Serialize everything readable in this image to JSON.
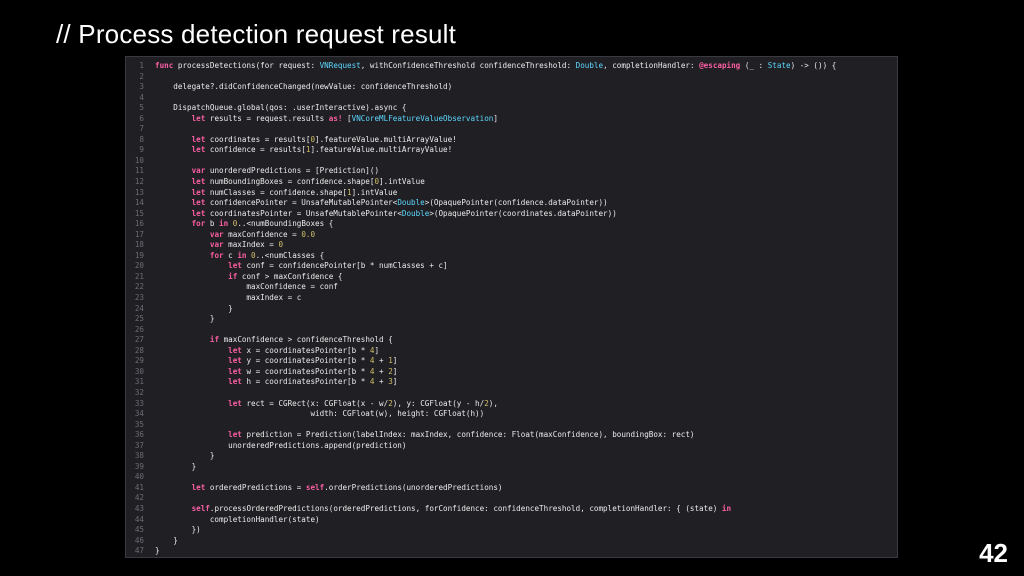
{
  "slide": {
    "title": "// Process detection request result",
    "page_number": "42"
  },
  "colors": {
    "background": "#000000",
    "panel": "#1f1f24",
    "keyword": "#fc5fa3",
    "type": "#5dd8ff",
    "number": "#d0bf69",
    "line_number": "#6c6c74",
    "text": "#ececec"
  },
  "code": {
    "lines": [
      {
        "n": "1",
        "tokens": [
          {
            "t": "func",
            "c": "keyword"
          },
          {
            "t": " processDetections(for request: "
          },
          {
            "t": "VNRequest",
            "c": "type"
          },
          {
            "t": ", withConfidenceThreshold confidenceThreshold: "
          },
          {
            "t": "Double",
            "c": "type"
          },
          {
            "t": ", completionHandler: "
          },
          {
            "t": "@escaping",
            "c": "keyword"
          },
          {
            "t": " (_ : "
          },
          {
            "t": "State",
            "c": "type"
          },
          {
            "t": ") -> ()) {"
          }
        ]
      },
      {
        "n": "2",
        "tokens": []
      },
      {
        "n": "3",
        "tokens": [
          {
            "t": "    delegate?.didConfidenceChanged(newValue: confidenceThreshold)"
          }
        ]
      },
      {
        "n": "4",
        "tokens": []
      },
      {
        "n": "5",
        "tokens": [
          {
            "t": "    DispatchQueue.global(qos: .userInteractive).async {"
          }
        ]
      },
      {
        "n": "6",
        "tokens": [
          {
            "t": "        "
          },
          {
            "t": "let",
            "c": "keyword"
          },
          {
            "t": " results = request.results "
          },
          {
            "t": "as!",
            "c": "keyword"
          },
          {
            "t": " ["
          },
          {
            "t": "VNCoreMLFeatureValueObservation",
            "c": "type"
          },
          {
            "t": "]"
          }
        ]
      },
      {
        "n": "7",
        "tokens": []
      },
      {
        "n": "8",
        "tokens": [
          {
            "t": "        "
          },
          {
            "t": "let",
            "c": "keyword"
          },
          {
            "t": " coordinates = results["
          },
          {
            "t": "0",
            "c": "number"
          },
          {
            "t": "].featureValue.multiArrayValue!"
          }
        ]
      },
      {
        "n": "9",
        "tokens": [
          {
            "t": "        "
          },
          {
            "t": "let",
            "c": "keyword"
          },
          {
            "t": " confidence = results["
          },
          {
            "t": "1",
            "c": "number"
          },
          {
            "t": "].featureValue.multiArrayValue!"
          }
        ]
      },
      {
        "n": "10",
        "tokens": []
      },
      {
        "n": "11",
        "tokens": [
          {
            "t": "        "
          },
          {
            "t": "var",
            "c": "keyword"
          },
          {
            "t": " unorderedPredictions = [Prediction]()"
          }
        ]
      },
      {
        "n": "12",
        "tokens": [
          {
            "t": "        "
          },
          {
            "t": "let",
            "c": "keyword"
          },
          {
            "t": " numBoundingBoxes = confidence.shape["
          },
          {
            "t": "0",
            "c": "number"
          },
          {
            "t": "].intValue"
          }
        ]
      },
      {
        "n": "13",
        "tokens": [
          {
            "t": "        "
          },
          {
            "t": "let",
            "c": "keyword"
          },
          {
            "t": " numClasses = confidence.shape["
          },
          {
            "t": "1",
            "c": "number"
          },
          {
            "t": "].intValue"
          }
        ]
      },
      {
        "n": "14",
        "tokens": [
          {
            "t": "        "
          },
          {
            "t": "let",
            "c": "keyword"
          },
          {
            "t": " confidencePointer = UnsafeMutablePointer<"
          },
          {
            "t": "Double",
            "c": "type"
          },
          {
            "t": ">(OpaquePointer(confidence.dataPointer))"
          }
        ]
      },
      {
        "n": "15",
        "tokens": [
          {
            "t": "        "
          },
          {
            "t": "let",
            "c": "keyword"
          },
          {
            "t": " coordinatesPointer = UnsafeMutablePointer<"
          },
          {
            "t": "Double",
            "c": "type"
          },
          {
            "t": ">(OpaquePointer(coordinates.dataPointer))"
          }
        ]
      },
      {
        "n": "16",
        "tokens": [
          {
            "t": "        "
          },
          {
            "t": "for",
            "c": "keyword"
          },
          {
            "t": " b "
          },
          {
            "t": "in",
            "c": "keyword"
          },
          {
            "t": " "
          },
          {
            "t": "0",
            "c": "number"
          },
          {
            "t": "..<numBoundingBoxes {"
          }
        ]
      },
      {
        "n": "17",
        "tokens": [
          {
            "t": "            "
          },
          {
            "t": "var",
            "c": "keyword"
          },
          {
            "t": " maxConfidence = "
          },
          {
            "t": "0.0",
            "c": "number"
          }
        ]
      },
      {
        "n": "18",
        "tokens": [
          {
            "t": "            "
          },
          {
            "t": "var",
            "c": "keyword"
          },
          {
            "t": " maxIndex = "
          },
          {
            "t": "0",
            "c": "number"
          }
        ]
      },
      {
        "n": "19",
        "tokens": [
          {
            "t": "            "
          },
          {
            "t": "for",
            "c": "keyword"
          },
          {
            "t": " c "
          },
          {
            "t": "in",
            "c": "keyword"
          },
          {
            "t": " "
          },
          {
            "t": "0",
            "c": "number"
          },
          {
            "t": "..<numClasses {"
          }
        ]
      },
      {
        "n": "20",
        "tokens": [
          {
            "t": "                "
          },
          {
            "t": "let",
            "c": "keyword"
          },
          {
            "t": " conf = confidencePointer[b * numClasses + c]"
          }
        ]
      },
      {
        "n": "21",
        "tokens": [
          {
            "t": "                "
          },
          {
            "t": "if",
            "c": "keyword"
          },
          {
            "t": " conf > maxConfidence {"
          }
        ]
      },
      {
        "n": "22",
        "tokens": [
          {
            "t": "                    maxConfidence = conf"
          }
        ]
      },
      {
        "n": "23",
        "tokens": [
          {
            "t": "                    maxIndex = c"
          }
        ]
      },
      {
        "n": "24",
        "tokens": [
          {
            "t": "                }"
          }
        ]
      },
      {
        "n": "25",
        "tokens": [
          {
            "t": "            }"
          }
        ]
      },
      {
        "n": "26",
        "tokens": []
      },
      {
        "n": "27",
        "tokens": [
          {
            "t": "            "
          },
          {
            "t": "if",
            "c": "keyword"
          },
          {
            "t": " maxConfidence > confidenceThreshold {"
          }
        ]
      },
      {
        "n": "28",
        "tokens": [
          {
            "t": "                "
          },
          {
            "t": "let",
            "c": "keyword"
          },
          {
            "t": " x = coordinatesPointer[b * "
          },
          {
            "t": "4",
            "c": "number"
          },
          {
            "t": "]"
          }
        ]
      },
      {
        "n": "29",
        "tokens": [
          {
            "t": "                "
          },
          {
            "t": "let",
            "c": "keyword"
          },
          {
            "t": " y = coordinatesPointer[b * "
          },
          {
            "t": "4",
            "c": "number"
          },
          {
            "t": " + "
          },
          {
            "t": "1",
            "c": "number"
          },
          {
            "t": "]"
          }
        ]
      },
      {
        "n": "30",
        "tokens": [
          {
            "t": "                "
          },
          {
            "t": "let",
            "c": "keyword"
          },
          {
            "t": " w = coordinatesPointer[b * "
          },
          {
            "t": "4",
            "c": "number"
          },
          {
            "t": " + "
          },
          {
            "t": "2",
            "c": "number"
          },
          {
            "t": "]"
          }
        ]
      },
      {
        "n": "31",
        "tokens": [
          {
            "t": "                "
          },
          {
            "t": "let",
            "c": "keyword"
          },
          {
            "t": " h = coordinatesPointer[b * "
          },
          {
            "t": "4",
            "c": "number"
          },
          {
            "t": " + "
          },
          {
            "t": "3",
            "c": "number"
          },
          {
            "t": "]"
          }
        ]
      },
      {
        "n": "32",
        "tokens": []
      },
      {
        "n": "33",
        "tokens": [
          {
            "t": "                "
          },
          {
            "t": "let",
            "c": "keyword"
          },
          {
            "t": " rect = CGRect(x: CGFloat(x - w/"
          },
          {
            "t": "2",
            "c": "number"
          },
          {
            "t": "), y: CGFloat(y - h/"
          },
          {
            "t": "2",
            "c": "number"
          },
          {
            "t": "),"
          }
        ]
      },
      {
        "n": "34",
        "tokens": [
          {
            "t": "                                  width: CGFloat(w), height: CGFloat(h))"
          }
        ]
      },
      {
        "n": "35",
        "tokens": []
      },
      {
        "n": "36",
        "tokens": [
          {
            "t": "                "
          },
          {
            "t": "let",
            "c": "keyword"
          },
          {
            "t": " prediction = Prediction(labelIndex: maxIndex, confidence: Float(maxConfidence), boundingBox: rect)"
          }
        ]
      },
      {
        "n": "37",
        "tokens": [
          {
            "t": "                unorderedPredictions.append(prediction)"
          }
        ]
      },
      {
        "n": "38",
        "tokens": [
          {
            "t": "            }"
          }
        ]
      },
      {
        "n": "39",
        "tokens": [
          {
            "t": "        }"
          }
        ]
      },
      {
        "n": "40",
        "tokens": []
      },
      {
        "n": "41",
        "tokens": [
          {
            "t": "        "
          },
          {
            "t": "let",
            "c": "keyword"
          },
          {
            "t": " orderedPredictions = "
          },
          {
            "t": "self",
            "c": "keyword"
          },
          {
            "t": ".orderPredictions(unorderedPredictions)"
          }
        ]
      },
      {
        "n": "42",
        "tokens": []
      },
      {
        "n": "43",
        "tokens": [
          {
            "t": "        "
          },
          {
            "t": "self",
            "c": "keyword"
          },
          {
            "t": ".processOrderedPredictions(orderedPredictions, forConfidence: confidenceThreshold, completionHandler: { (state) "
          },
          {
            "t": "in",
            "c": "keyword"
          }
        ]
      },
      {
        "n": "44",
        "tokens": [
          {
            "t": "            completionHandler(state)"
          }
        ]
      },
      {
        "n": "45",
        "tokens": [
          {
            "t": "        })"
          }
        ]
      },
      {
        "n": "46",
        "tokens": [
          {
            "t": "    }"
          }
        ]
      },
      {
        "n": "47",
        "tokens": [
          {
            "t": "}"
          }
        ]
      }
    ]
  }
}
